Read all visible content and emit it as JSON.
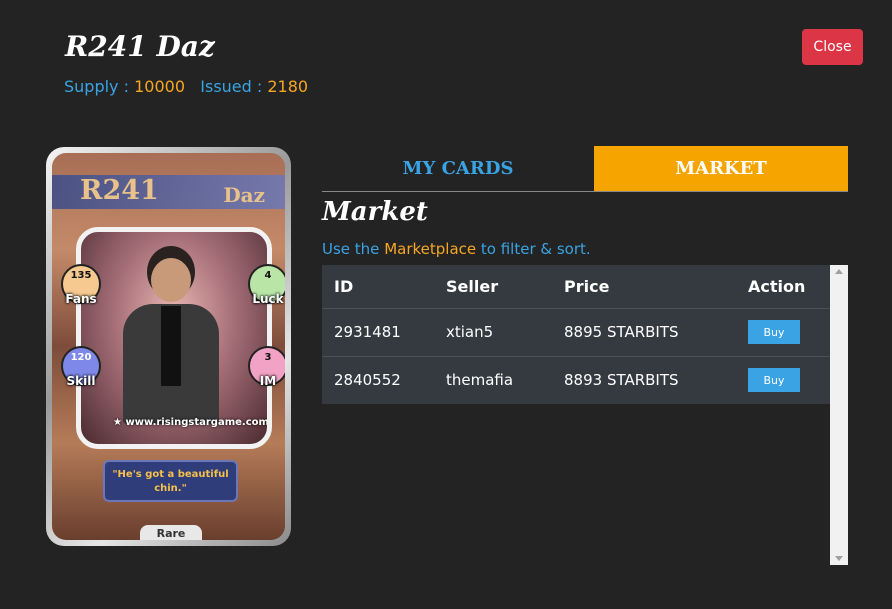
{
  "header": {
    "title": "R241 Daz",
    "supply_label": "Supply :",
    "supply_value": "10000",
    "issued_label": "Issued :",
    "issued_value": "2180",
    "close_label": "Close"
  },
  "card": {
    "code": "R241",
    "name": "Daz",
    "stats": {
      "fans": {
        "value": "135",
        "label": "Fans"
      },
      "luck": {
        "value": "4",
        "label": "Luck"
      },
      "skill": {
        "value": "120",
        "label": "Skill"
      },
      "im": {
        "value": "3",
        "label": "IM"
      }
    },
    "website": "www.risingstargame.com",
    "quote": "\"He's got a beautiful chin.\"",
    "rarity": "Rare"
  },
  "tabs": [
    {
      "label": "MY CARDS",
      "active": false
    },
    {
      "label": "MARKET",
      "active": true
    }
  ],
  "market": {
    "heading": "Market",
    "help_prefix": "Use the",
    "help_link": "Marketplace",
    "help_suffix": "to filter & sort.",
    "columns": [
      "ID",
      "Seller",
      "Price",
      "Action"
    ],
    "rows": [
      {
        "id": "2931481",
        "seller": "xtian5",
        "price": "8895 STARBITS",
        "action": "Buy"
      },
      {
        "id": "2840552",
        "seller": "themafia",
        "price": "8893 STARBITS",
        "action": "Buy"
      }
    ]
  },
  "colors": {
    "accent_blue": "#3aa3e3",
    "accent_orange": "#f6a400",
    "close_red": "#dc3545",
    "table_bg": "#343a40"
  }
}
